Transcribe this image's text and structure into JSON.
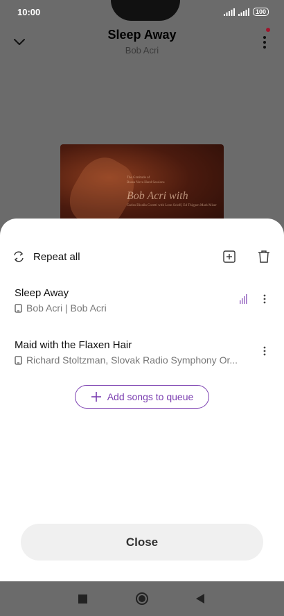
{
  "status_bar": {
    "time": "10:00",
    "battery": "100"
  },
  "player": {
    "title": "Sleep Away",
    "artist": "Bob Acri",
    "album_art_text": {
      "line1": "The Gratitude of",
      "line2": "Bossa Nova Hand Sessions",
      "name": "Bob Acri with",
      "line3": "Carlos Dicalla Coretti with Leon Scioff, Ed Thigpen Mark Miser"
    }
  },
  "queue": {
    "repeat_label": "Repeat all",
    "items": [
      {
        "title": "Sleep Away",
        "subtitle": "Bob Acri | Bob Acri",
        "playing": true
      },
      {
        "title": "Maid with the Flaxen Hair",
        "subtitle": "Richard Stoltzman, Slovak Radio Symphony Or...",
        "playing": false
      }
    ],
    "add_songs_label": "Add songs to queue",
    "close_label": "Close"
  },
  "colors": {
    "accent": "#7a3db0",
    "scrim": "#6b6b6b",
    "sheet": "#ffffff"
  },
  "icons": [
    "chevron-down-icon",
    "more-vert-icon",
    "repeat-icon",
    "add-to-queue-icon",
    "trash-icon",
    "device-icon",
    "equalizer-icon",
    "plus-icon",
    "recents-icon",
    "home-icon",
    "back-icon"
  ]
}
